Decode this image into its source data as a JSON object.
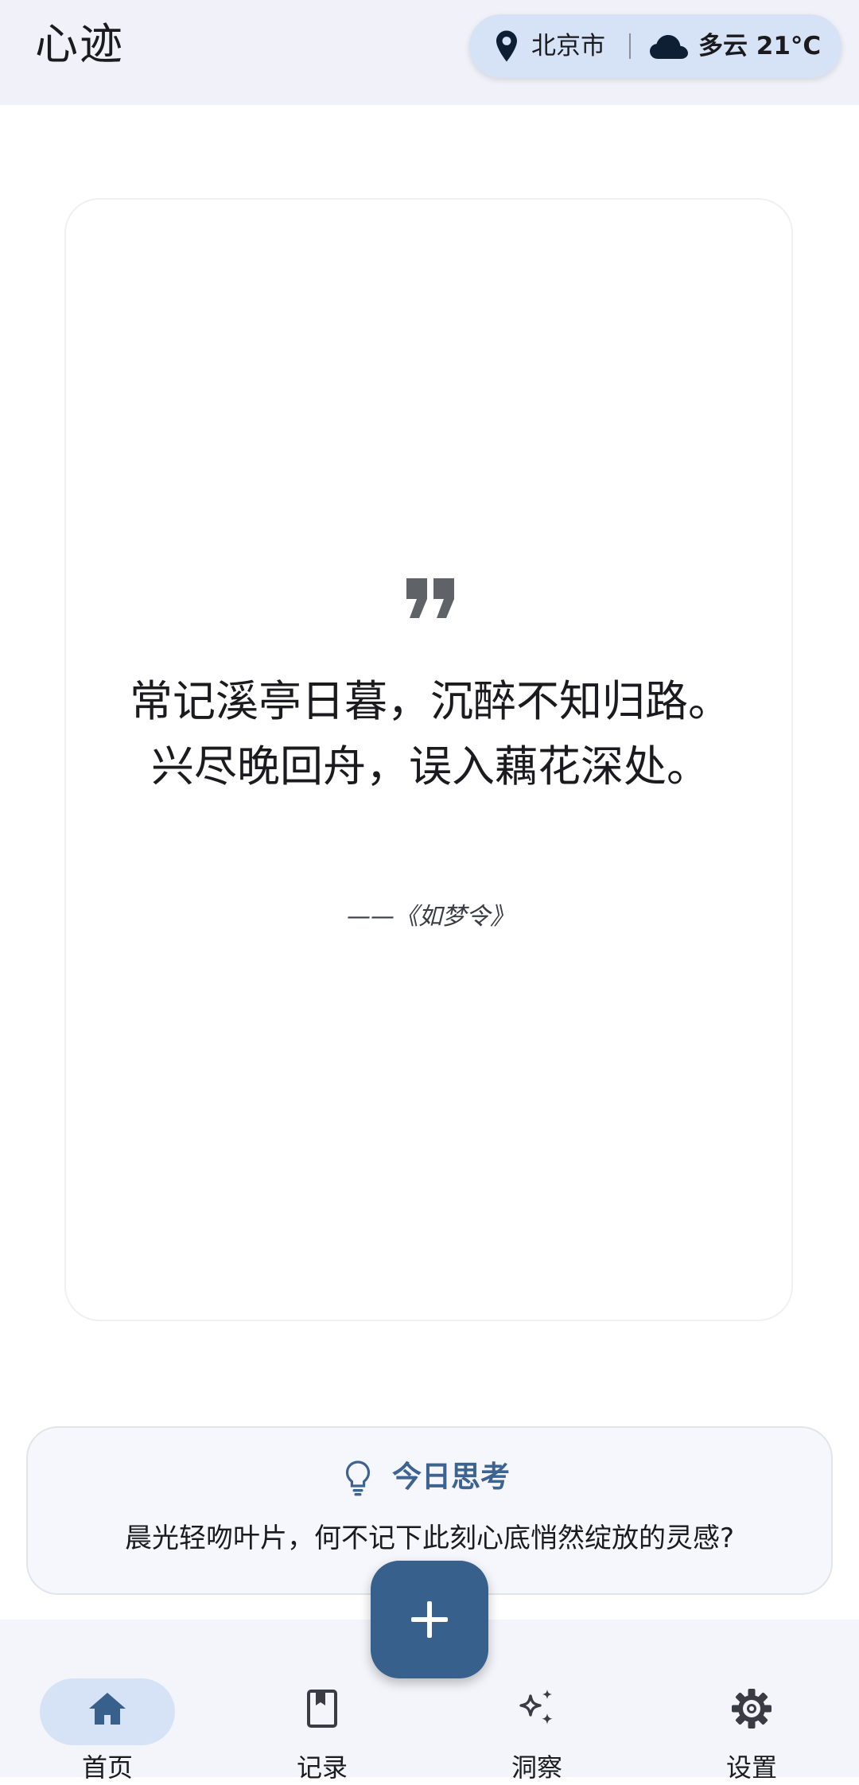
{
  "app": {
    "title": "心迹"
  },
  "header": {
    "location": "北京市",
    "weather": "多云 21°C"
  },
  "quote": {
    "text": "常记溪亭日暮，沉醉不知归路。兴尽晚回舟，误入藕花深处。",
    "source": "——《如梦令》"
  },
  "daily_thought": {
    "title": "今日思考",
    "text": "晨光轻吻叶片，何不记下此刻心底悄然绽放的灵感?"
  },
  "nav": {
    "items": [
      {
        "label": "首页",
        "icon": "home-icon",
        "active": true
      },
      {
        "label": "记录",
        "icon": "book-icon",
        "active": false
      },
      {
        "label": "洞察",
        "icon": "sparkle-icon",
        "active": false
      },
      {
        "label": "设置",
        "icon": "gear-icon",
        "active": false
      }
    ]
  },
  "colors": {
    "accent": "#37608d",
    "active_pill": "#d6e3f7",
    "thought_title": "#3d6491"
  }
}
